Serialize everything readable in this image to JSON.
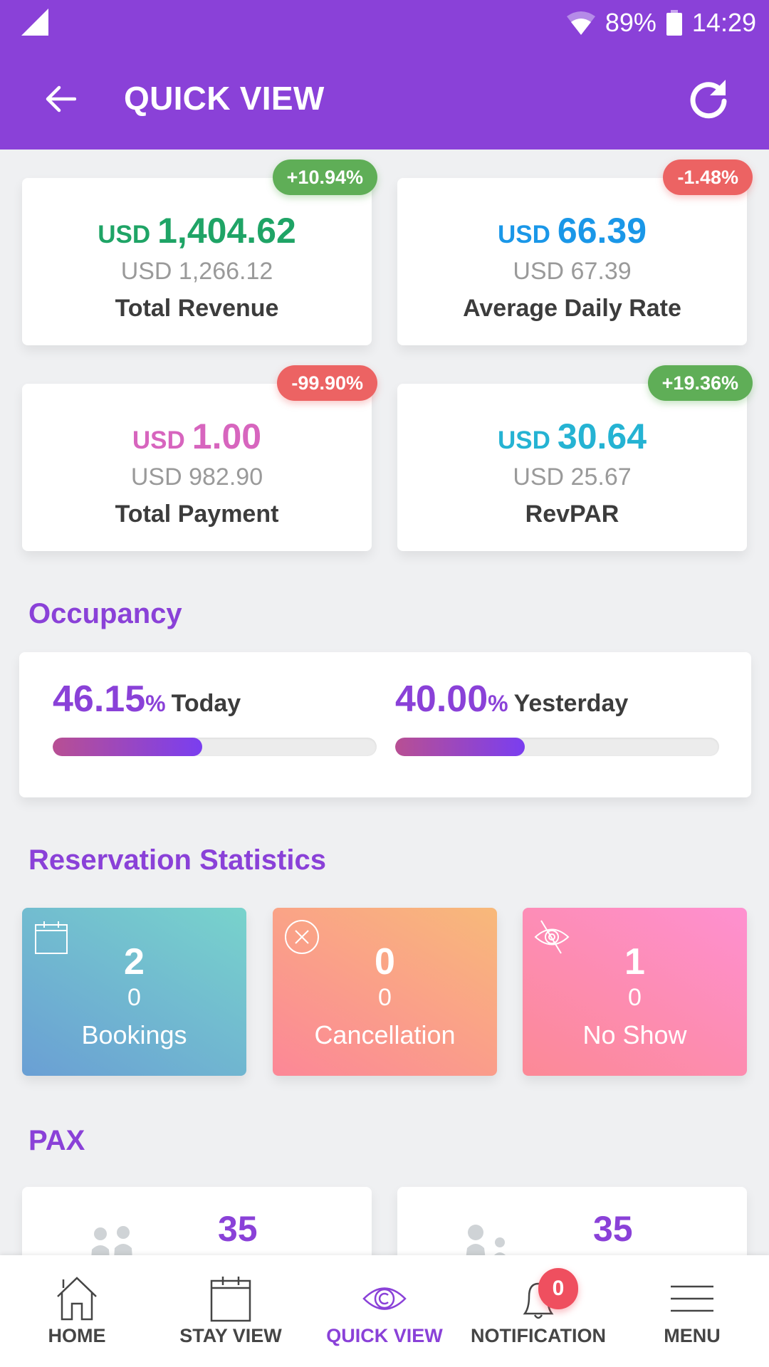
{
  "status_bar": {
    "battery": "89%",
    "time": "14:29"
  },
  "header": {
    "title": "QUICK VIEW"
  },
  "kpis": [
    {
      "currency": "USD",
      "value": "1,404.62",
      "previous": "USD 1,266.12",
      "label": "Total Revenue",
      "change": "+10.94%",
      "trend": "up",
      "color": "#1fa466"
    },
    {
      "currency": "USD",
      "value": "66.39",
      "previous": "USD 67.39",
      "label": "Average Daily Rate",
      "change": "-1.48%",
      "trend": "down",
      "color": "#1a97e8"
    },
    {
      "currency": "USD",
      "value": "1.00",
      "previous": "USD 982.90",
      "label": "Total Payment",
      "change": "-99.90%",
      "trend": "down",
      "color": "#d765be"
    },
    {
      "currency": "USD",
      "value": "30.64",
      "previous": "USD 25.67",
      "label": "RevPAR",
      "change": "+19.36%",
      "trend": "up",
      "color": "#25b3d3"
    }
  ],
  "occupancy": {
    "title": "Occupancy",
    "today": {
      "value": "46.15",
      "unit": "%",
      "label": "Today",
      "fraction": 0.4615
    },
    "yesterday": {
      "value": "40.00",
      "unit": "%",
      "label": "Yesterday",
      "fraction": 0.4
    }
  },
  "reservations": {
    "title": "Reservation Statistics",
    "items": [
      {
        "icon": "calendar-icon",
        "count": "2",
        "previous": "0",
        "label": "Bookings"
      },
      {
        "icon": "cancel-circle-icon",
        "count": "0",
        "previous": "0",
        "label": "Cancellation"
      },
      {
        "icon": "eye-off-icon",
        "count": "1",
        "previous": "0",
        "label": "No Show"
      }
    ]
  },
  "pax": {
    "title": "PAX",
    "items": [
      {
        "icon": "adults-icon",
        "value": "35"
      },
      {
        "icon": "adult-child-icon",
        "value": "35"
      }
    ]
  },
  "bottom_nav": {
    "items": [
      {
        "icon": "home-icon",
        "label": "HOME"
      },
      {
        "icon": "calendar-icon",
        "label": "STAY VIEW"
      },
      {
        "icon": "eye-icon",
        "label": "QUICK VIEW",
        "active": true
      },
      {
        "icon": "bell-icon",
        "label": "NOTIFICATION",
        "badge": "0"
      },
      {
        "icon": "hamburger-icon",
        "label": "MENU"
      }
    ]
  },
  "colors": {
    "brand": "#8a41d8",
    "up": "#5fae57",
    "down": "#ec6363"
  }
}
